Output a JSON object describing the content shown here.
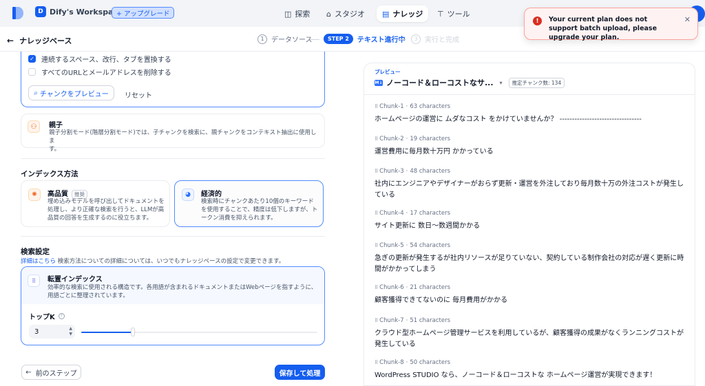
{
  "topbar": {
    "workspace_initial": "D",
    "workspace_name": "Dify's Workspace",
    "upgrade_label": "+ アップグレード",
    "nav": [
      {
        "label": "探索",
        "icon": "compass-icon"
      },
      {
        "label": "スタジオ",
        "icon": "robot-icon"
      },
      {
        "label": "ナレッジ",
        "icon": "book-icon",
        "active": true
      },
      {
        "label": "ツール",
        "icon": "hammer-icon"
      }
    ]
  },
  "toast": {
    "message": "Your current plan does not support batch upload, please upgrade your plan.",
    "icon": "error-icon"
  },
  "header": {
    "back_title": "ナレッジベース",
    "steps": [
      {
        "num": "1",
        "label": "データソース"
      },
      {
        "num": "STEP 2",
        "label": "テキスト進行中"
      },
      {
        "num": "3",
        "label": "実行と完成"
      }
    ]
  },
  "segment": {
    "rule1": "連続するスペース、改行、タブを置換する",
    "rule1_checked": true,
    "rule2": "すべてのURLとメールアドレスを削除する",
    "rule2_checked": false,
    "preview_btn": "チャンクをプレビュー",
    "reset_btn": "リセット"
  },
  "parent_mode": {
    "title": "親子",
    "desc": "親子分割モード(階層分割モード)では、子チャンクを検索に、親チャンクをコンテキスト抽出に使用しま",
    "desc2": "す。"
  },
  "index": {
    "section": "インデックス方法",
    "high_title": "高品質",
    "high_tag": "推奨",
    "high_desc": "埋め込みモデルを呼び出してドキュメントを処理し、より正確な検索を行うと、LLMが高品質の回答を生成するのに役立ちます。",
    "eco_title": "経済的",
    "eco_desc": "検索時にチャンクあたり10個のキーワードを使用することで、精度は低下しますが、トークン消費を抑えられます。"
  },
  "retrieval": {
    "section": "検索設定",
    "link": "詳細はこちら",
    "note": " 検索方法についての詳細については、いつでもナレッジベースの設定で変更できます。",
    "method_title": "転置インデックス",
    "method_desc": "効率的な検索に使用される構造です。各用語が含まれるドキュメントまたはWebページを指すように、用語ごとに整理されています。",
    "topk_label": "トップK",
    "topk_value": "3",
    "topk_slider_fraction": 0.22
  },
  "footer": {
    "prev_btn": "前のステップ",
    "save_btn": "保存して処理"
  },
  "preview": {
    "label": "プレビュー",
    "doc_badge": "M↓",
    "doc_name": "ノーコード＆ローコストなサ...",
    "estimate": "推定チャンク数: 134",
    "chunks": [
      {
        "id": "Chunk-1",
        "chars": "63 characters",
        "text": "ホームページの運営に ムダなコスト をかけていませんか？ ---------------------------------"
      },
      {
        "id": "Chunk-2",
        "chars": "19 characters",
        "text": "運営費用に毎月数十万円 かかっている"
      },
      {
        "id": "Chunk-3",
        "chars": "48 characters",
        "text": "社内にエンジニアやデザイナーがおらず更新・運営を外注しており毎月数十万の外注コストが発生している"
      },
      {
        "id": "Chunk-4",
        "chars": "17 characters",
        "text": "サイト更新に 数日〜数週間かかる"
      },
      {
        "id": "Chunk-5",
        "chars": "54 characters",
        "text": "急ぎの更新が発生するが社内リソースが足りていない、契約している制作会社の対応が遅く更新に時間がかかってしまう"
      },
      {
        "id": "Chunk-6",
        "chars": "21 characters",
        "text": "顧客獲得できてないのに 毎月費用がかかる"
      },
      {
        "id": "Chunk-7",
        "chars": "51 characters",
        "text": "クラウド型ホームページ管理サービスを利用しているが、顧客獲得の成果がなくランニングコストが発生している"
      },
      {
        "id": "Chunk-8",
        "chars": "50 characters",
        "text": "WordPress STUDIO なら、ノーコード＆ローコストな ホームページ運営が実現できます！"
      }
    ]
  }
}
